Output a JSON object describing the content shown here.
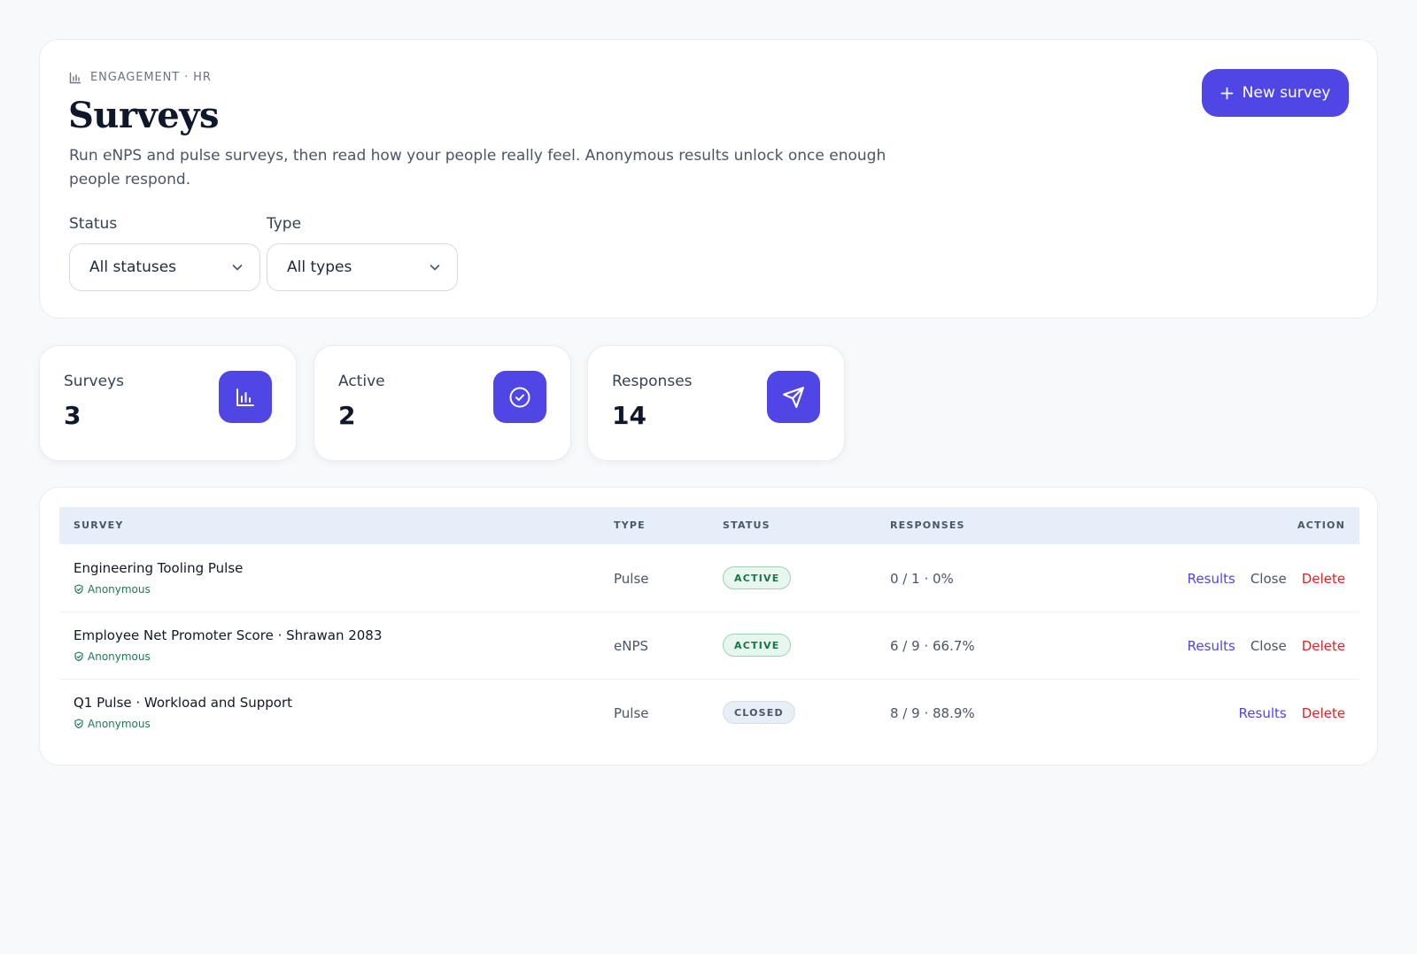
{
  "header": {
    "eyebrow": "ENGAGEMENT · HR",
    "title": "Surveys",
    "description": "Run eNPS and pulse surveys, then read how your people really feel. Anonymous results unlock once enough people respond.",
    "new_button_label": "New survey"
  },
  "filters": {
    "status": {
      "label": "Status",
      "value": "All statuses"
    },
    "type": {
      "label": "Type",
      "value": "All types"
    }
  },
  "stats": [
    {
      "label": "Surveys",
      "value": "3",
      "icon": "bar-chart-icon"
    },
    {
      "label": "Active",
      "value": "2",
      "icon": "check-circle-icon"
    },
    {
      "label": "Responses",
      "value": "14",
      "icon": "send-icon"
    }
  ],
  "table": {
    "headers": {
      "survey": "SURVEY",
      "type": "TYPE",
      "status": "STATUS",
      "responses": "RESPONSES",
      "action": "ACTION"
    },
    "rows": [
      {
        "name": "Engineering Tooling Pulse",
        "privacy": "Anonymous",
        "type": "Pulse",
        "status": "ACTIVE",
        "responses": "0 / 1 · 0%",
        "results": "Results",
        "close": "Close",
        "delete": "Delete"
      },
      {
        "name": "Employee Net Promoter Score · Shrawan 2083",
        "privacy": "Anonymous",
        "type": "eNPS",
        "status": "ACTIVE",
        "responses": "6 / 9 · 66.7%",
        "results": "Results",
        "close": "Close",
        "delete": "Delete"
      },
      {
        "name": "Q1 Pulse · Workload and Support",
        "privacy": "Anonymous",
        "type": "Pulse",
        "status": "CLOSED",
        "responses": "8 / 9 · 88.9%",
        "results": "Results",
        "delete": "Delete"
      }
    ]
  },
  "colors": {
    "accent": "#4f46e5",
    "active_badge": "#17754a",
    "delete": "#dc2626",
    "anonymous": "#1f7a52"
  }
}
